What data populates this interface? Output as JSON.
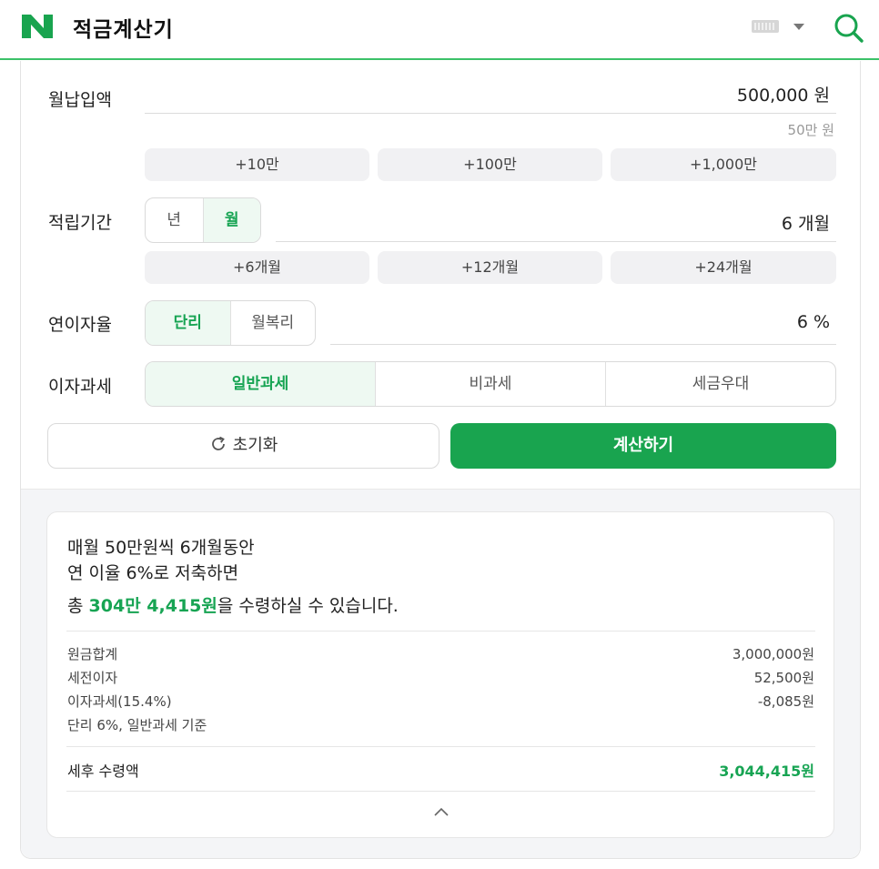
{
  "header": {
    "logo_text": "N",
    "title": "적금계산기",
    "icons": [
      "keyboard-icon",
      "caret-down-icon",
      "search-icon"
    ],
    "brand_color": "#19a44f"
  },
  "monthly": {
    "label": "월납입액",
    "value": "500,000 원",
    "hint": "50만 원",
    "quick": [
      "+10만",
      "+100만",
      "+1,000만"
    ]
  },
  "period": {
    "label": "적립기간",
    "options": [
      "년",
      "월"
    ],
    "selected": "월",
    "value": "6 개월",
    "quick": [
      "+6개월",
      "+12개월",
      "+24개월"
    ]
  },
  "rate": {
    "label": "연이자율",
    "options": [
      "단리",
      "월복리"
    ],
    "selected": "단리",
    "value": "6 %"
  },
  "tax": {
    "label": "이자과세",
    "options": [
      "일반과세",
      "비과세",
      "세금우대"
    ],
    "selected": "일반과세"
  },
  "buttons": {
    "reset": "초기화",
    "calculate": "계산하기"
  },
  "result": {
    "line1": "매월 50만원씩 6개월동안",
    "line2": "연 이율 6%로 저축하면",
    "line3_prefix": "총 ",
    "line3_amount": "304만 4,415원",
    "line3_suffix": "을 수령하실 수 있습니다.",
    "details": [
      {
        "label": "원금합계",
        "value": "3,000,000원"
      },
      {
        "label": "세전이자",
        "value": "52,500원"
      },
      {
        "label": "이자과세(15.4%)",
        "value": "-8,085원"
      }
    ],
    "basis": "단리 6%, 일반과세 기준",
    "net_label": "세후 수령액",
    "net_value": "3,044,415원"
  }
}
